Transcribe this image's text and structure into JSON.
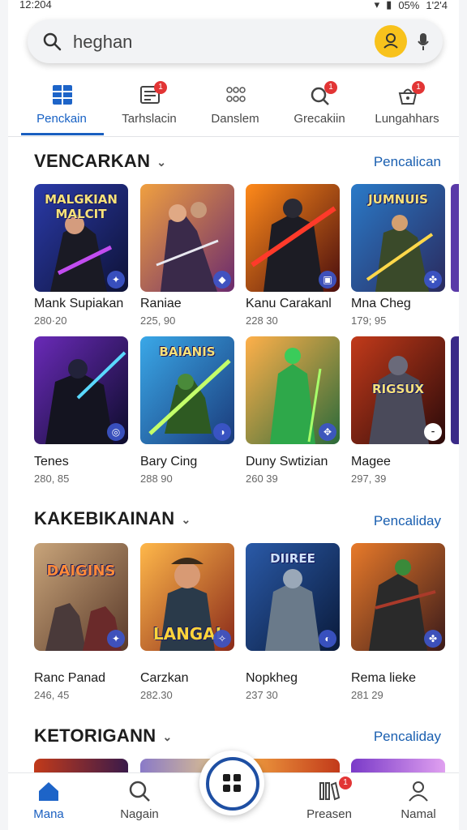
{
  "status": {
    "time": "12:204",
    "battery": "05%",
    "clock_right": "1'2'4"
  },
  "search": {
    "query": "heghan"
  },
  "tabs": [
    {
      "label": "Penckain",
      "icon": "grid-list-icon",
      "active": true
    },
    {
      "label": "Tarhslacin",
      "icon": "document-icon",
      "badge": "1"
    },
    {
      "label": "Danslem",
      "icon": "dots-icon"
    },
    {
      "label": "Grecakiin",
      "icon": "search-badge-icon",
      "badge": "1"
    },
    {
      "label": "Lungahhars",
      "icon": "basket-icon",
      "badge": "1"
    }
  ],
  "sections": [
    {
      "title": "VENCARKAN",
      "link": "Pencalican",
      "rows": [
        [
          {
            "name": "Mank Supiakan",
            "meta": "280·20",
            "art_text": "MALGKIAN MALCIT"
          },
          {
            "name": "Raniae",
            "meta": "225, 90"
          },
          {
            "name": "Kanu Carakanl",
            "meta": "228 30"
          },
          {
            "name": "Mna Cheg",
            "meta": "179; 95",
            "art_text": "JUMNUIS"
          }
        ],
        [
          {
            "name": "Tenes",
            "meta": "280, 85"
          },
          {
            "name": "Bary Cing",
            "meta": "288 90",
            "art_text": "BAIANIS"
          },
          {
            "name": "Duny Swtizian",
            "meta": "260 39"
          },
          {
            "name": "Magee",
            "meta": "297, 39",
            "art_text": "RIGSUX"
          }
        ]
      ]
    },
    {
      "title": "KAKEBIKAINAN",
      "link": "Pencaliday",
      "rows": [
        [
          {
            "name": "Ranc Panad",
            "meta": "246, 45",
            "art_text": "DAIGINS"
          },
          {
            "name": "Carzkan",
            "meta": "282.30",
            "art_text": "LANGAI"
          },
          {
            "name": "Nopkheg",
            "meta": "237 30",
            "art_text": "DIIREE"
          },
          {
            "name": "Rema lieke",
            "meta": "281 29"
          }
        ]
      ]
    },
    {
      "title": "KETORIGANN",
      "link": "Pencaliday",
      "rows": []
    }
  ],
  "bottom_nav": [
    {
      "label": "Mana",
      "icon": "home-icon",
      "active": true
    },
    {
      "label": "Nagain",
      "icon": "search-icon"
    },
    {
      "label": "Preasen",
      "icon": "library-icon",
      "badge": "1"
    },
    {
      "label": "Namal",
      "icon": "person-icon"
    }
  ],
  "colors": {
    "accent": "#1a5fc0",
    "badge": "#e23535",
    "fab_ring": "#1e4fa3"
  }
}
